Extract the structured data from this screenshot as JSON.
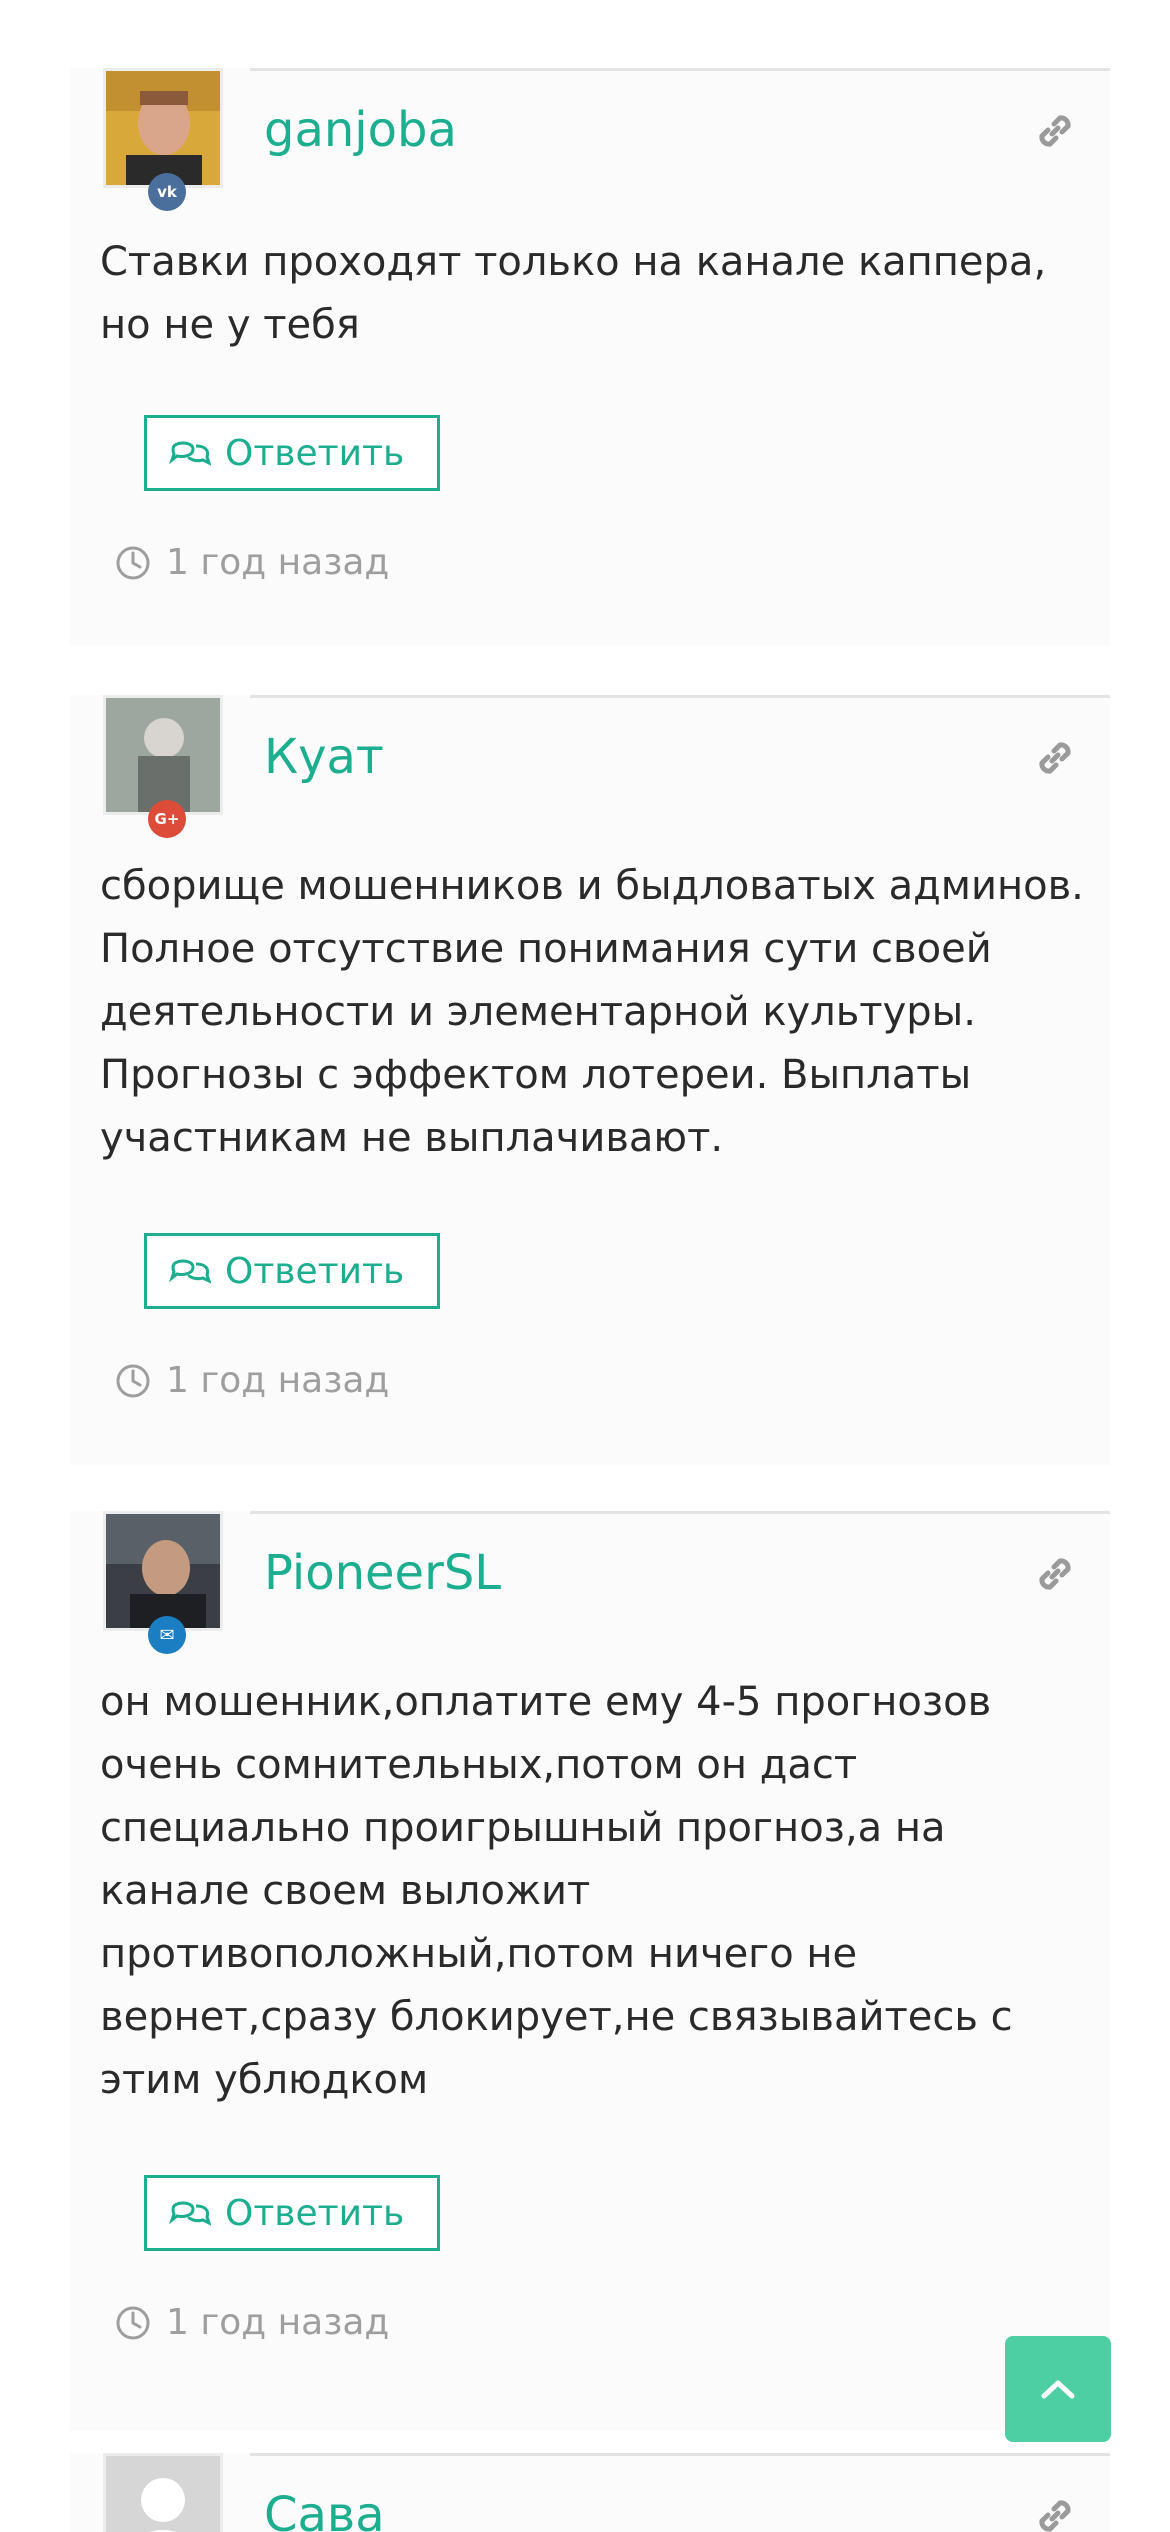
{
  "comments": [
    {
      "author": "ganjoba",
      "network": "vk",
      "badge_text": "vk",
      "badge_color": "#4a6f9c",
      "text": "Ставки проходят только на канале каппера, но не у тебя",
      "reply_label": "Ответить",
      "time": "1 год назад"
    },
    {
      "author": "Куат",
      "network": "google-plus",
      "badge_text": "G+",
      "badge_color": "#dd4b39",
      "text": "сборище мошенников и быдловатых админов. Полное отсутствие понимания сути своей деятельности и элементарной культуры. Прогнозы с эффектом лотереи. Выплаты участникам не выплачивают.",
      "reply_label": "Ответить",
      "time": "1 год назад"
    },
    {
      "author": "PioneerSL",
      "network": "email",
      "badge_text": "✉",
      "badge_color": "#1b7ec2",
      "text": "он мошенник,оплатите ему 4-5 прогнозов очень сомнительных,потом он даст специально проигрышный прогноз,а на канале своем выложит противоположный,потом ничего не вернет,сразу блокирует,не связывайтесь с этим ублюдком",
      "reply_label": "Ответить",
      "time": "1 год назад"
    },
    {
      "author": "Сава"
    }
  ],
  "colors": {
    "accent": "#1cae8e",
    "scroll_top_bg": "#4dcfa3",
    "muted_text": "#9e9e9e",
    "body_text": "#2a2a2a"
  },
  "icons": {
    "permalink": "link-icon",
    "reply": "comments-icon",
    "time": "clock-icon",
    "scroll_top": "chevron-up-icon"
  }
}
